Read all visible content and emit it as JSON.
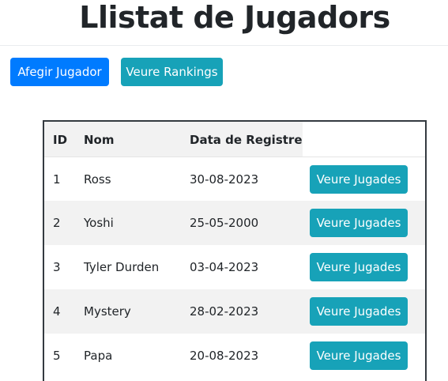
{
  "page": {
    "title": "Llistat de Jugadors"
  },
  "toolbar": {
    "add_player_label": "Afegir Jugador",
    "rankings_label": "Veure Rankings"
  },
  "table": {
    "headers": {
      "id": "ID",
      "name": "Nom",
      "date": "Data de Registre"
    },
    "action_label": "Veure Jugades",
    "rows": [
      {
        "id": "1",
        "name": "Ross",
        "date": "30-08-2023"
      },
      {
        "id": "2",
        "name": "Yoshi",
        "date": "25-05-2000"
      },
      {
        "id": "3",
        "name": "Tyler Durden",
        "date": "03-04-2023"
      },
      {
        "id": "4",
        "name": "Mystery",
        "date": "28-02-2023"
      },
      {
        "id": "5",
        "name": "Papa",
        "date": "20-08-2023"
      }
    ]
  },
  "colors": {
    "primary": "#007bff",
    "info": "#17a2b8",
    "stripe": "#f2f2f2",
    "table_border": "#343a40"
  }
}
